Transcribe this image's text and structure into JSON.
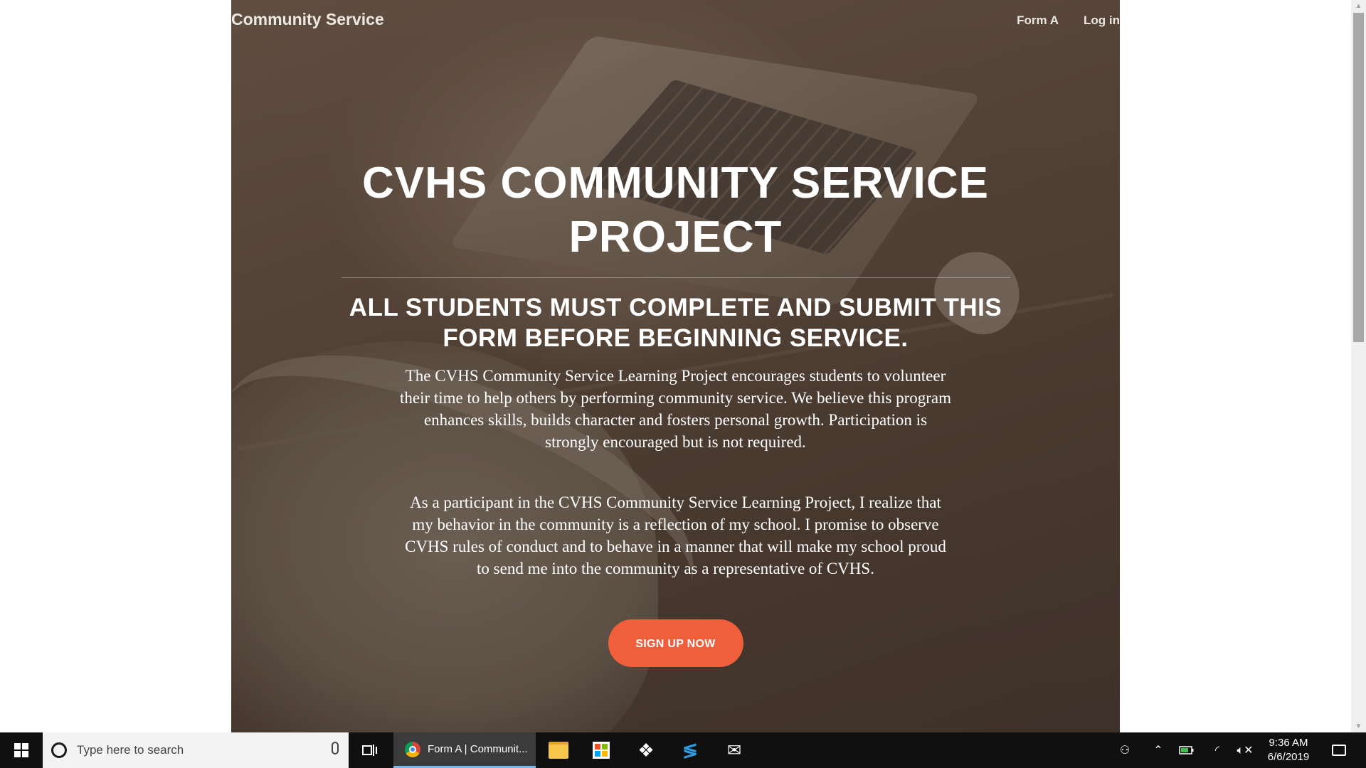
{
  "nav": {
    "brand": "Community Service",
    "links": [
      "Form A",
      "Log in"
    ]
  },
  "hero": {
    "title": "CVHS COMMUNITY SERVICE PROJECT",
    "subtitle": "ALL STUDENTS MUST COMPLETE AND SUBMIT THIS FORM BEFORE BEGINNING SERVICE.",
    "paragraph1": "The CVHS Community Service Learning Project encourages students to volunteer their time to help others by performing community service. We believe this program enhances skills, builds character and fosters personal growth. Participation is strongly encouraged but is not required.",
    "paragraph2": "As a participant in the CVHS Community Service Learning Project, I realize that my behavior in the community is a reflection of my school. I promise to observe CVHS rules of conduct and to behave in a manner that will make my school proud to send me into the community as a representative of CVHS.",
    "cta_label": "SIGN UP NOW",
    "accent_color": "#f05f3c"
  },
  "taskbar": {
    "search_placeholder": "Type here to search",
    "active_window_label": "Form A | Communit...",
    "pinned_apps": [
      "file-explorer-icon",
      "store-icon",
      "dropbox-icon",
      "visual-studio-icon",
      "mail-icon"
    ],
    "clock_time": "9:36 AM",
    "clock_date": "6/6/2019"
  }
}
